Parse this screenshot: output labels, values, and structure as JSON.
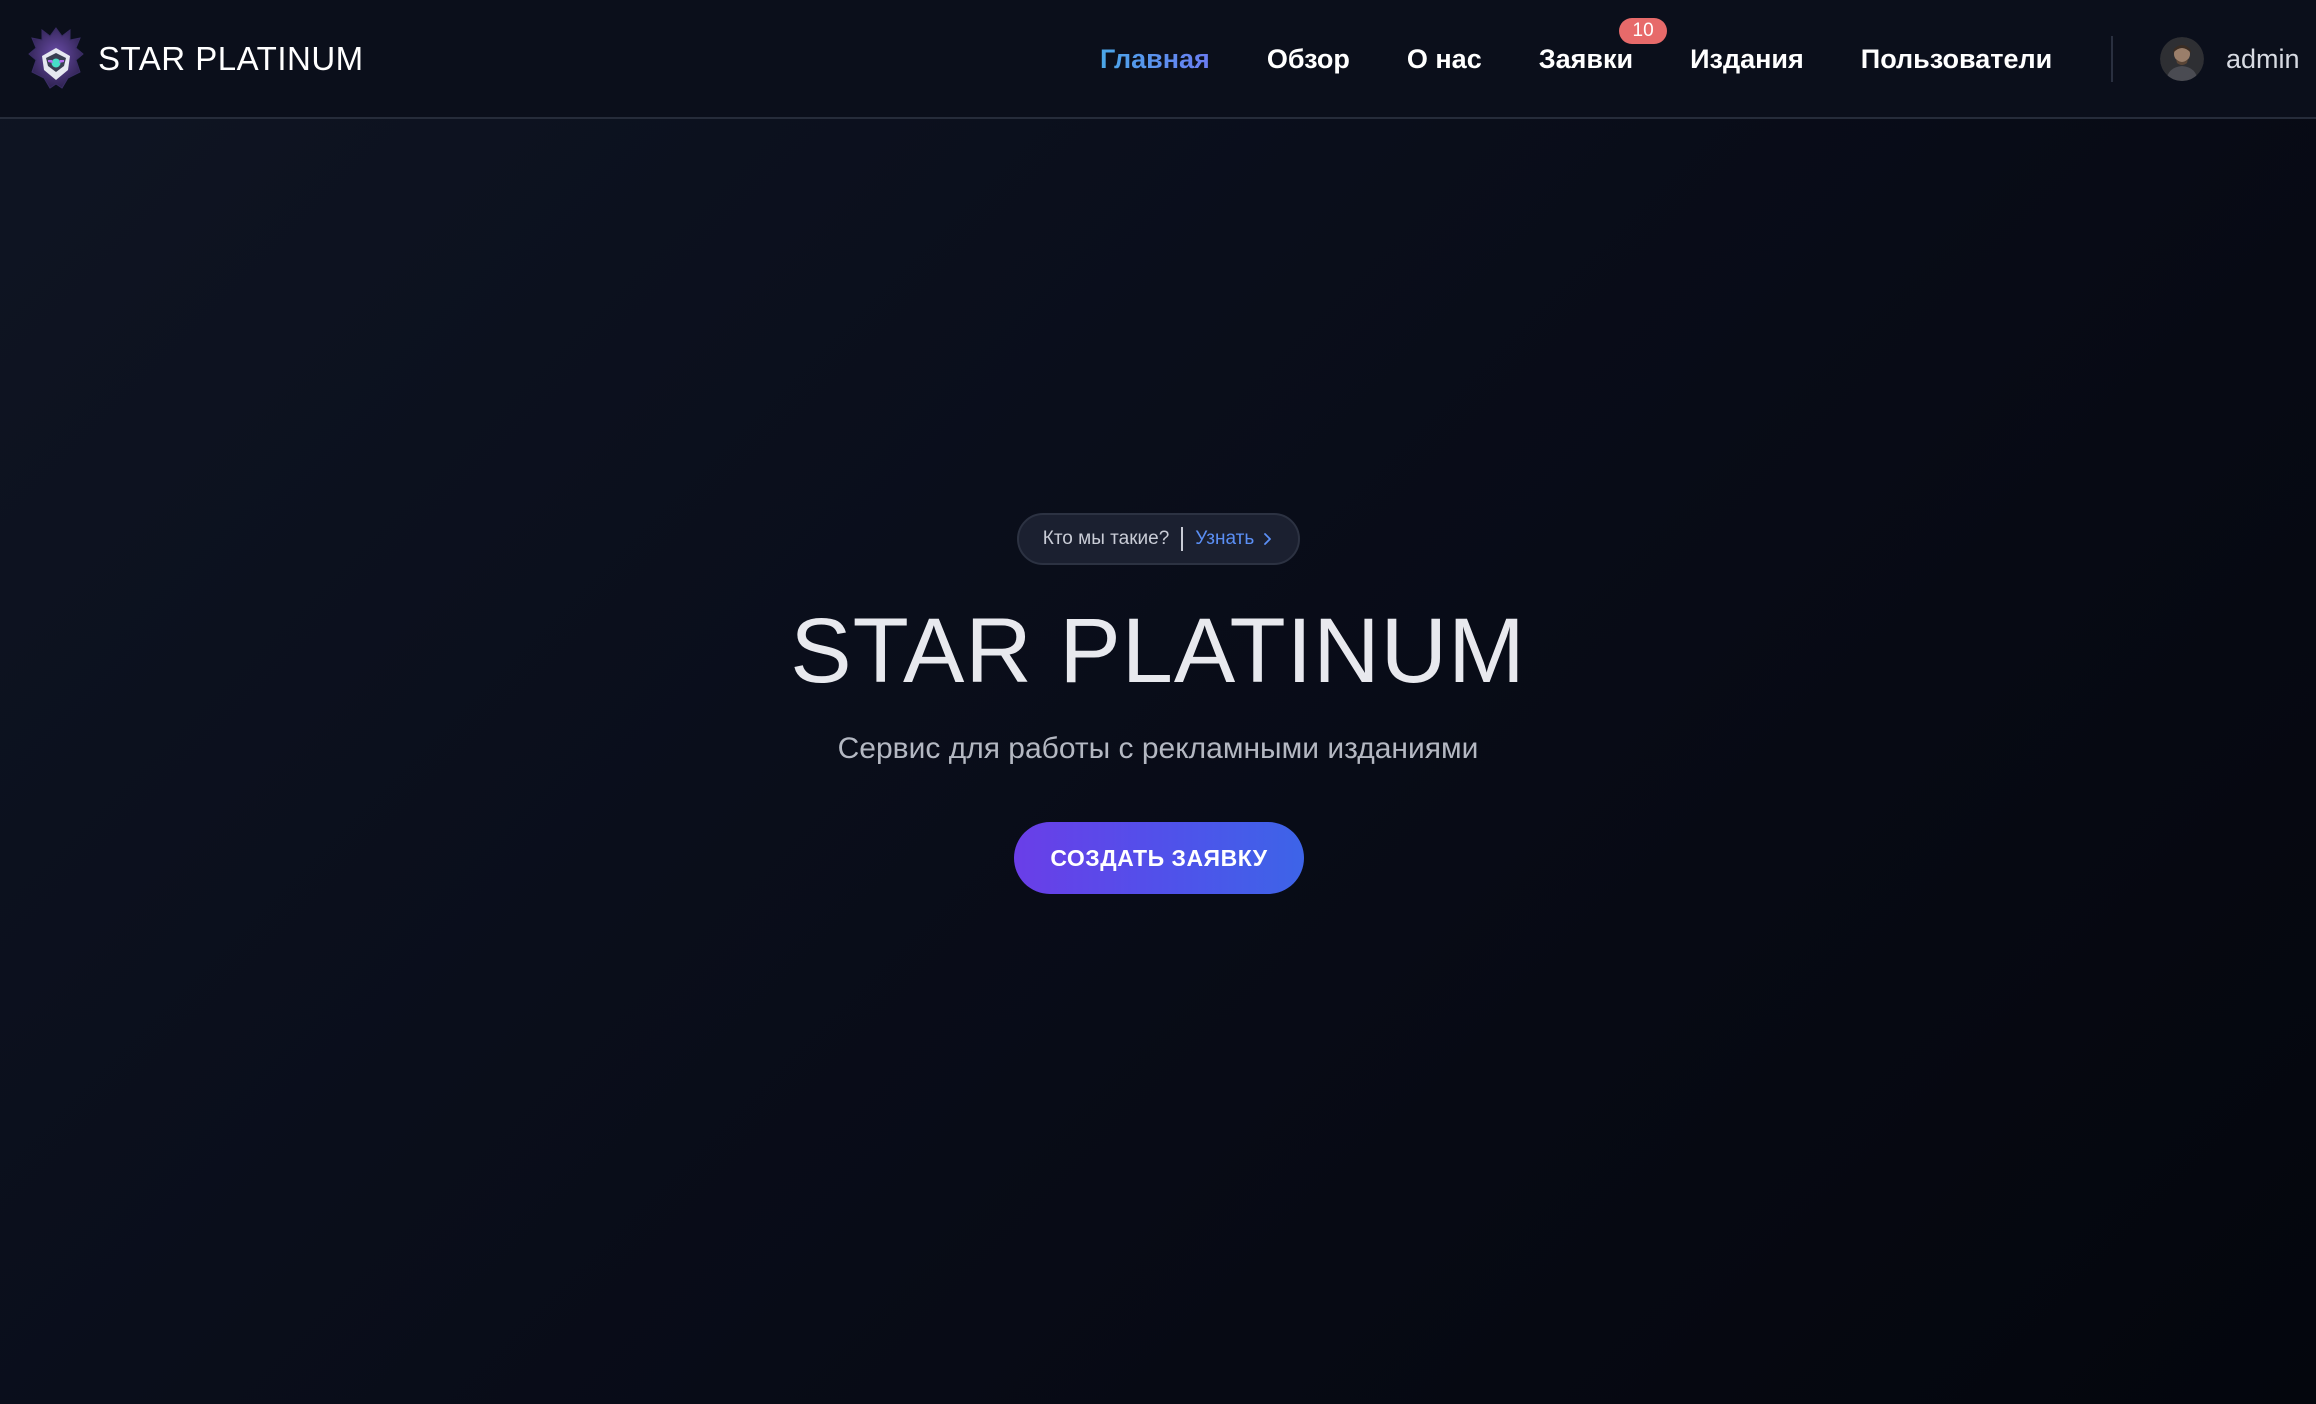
{
  "navbar": {
    "brand": {
      "name": "STAR PLATINUM",
      "logo_icon": "dark-mask-logo-icon"
    },
    "items": [
      {
        "label": "Главная",
        "active": true
      },
      {
        "label": "Обзор",
        "active": false
      },
      {
        "label": "О нас",
        "active": false
      },
      {
        "label": "Заявки",
        "active": false,
        "badge": "10"
      },
      {
        "label": "Издания",
        "active": false
      },
      {
        "label": "Пользователи",
        "active": false
      }
    ],
    "user": {
      "name": "admin",
      "avatar_icon": "user-avatar"
    }
  },
  "hero": {
    "pill": {
      "text": "Кто мы такие?",
      "link": "Узнать",
      "link_icon": "chevron-right-icon"
    },
    "title": "STAR PLATINUM",
    "subtitle": "Сервис для работы с рекламными изданиями",
    "cta_label": "СОЗДАТЬ ЗАЯВКУ"
  },
  "colors": {
    "background": "#070a14",
    "navbar_bg": "#0b0f1b",
    "active_nav": "#5aa6f0",
    "badge": "#e76a6a",
    "link": "#5b8ff5",
    "cta_gradient_start": "#6a3ee8",
    "cta_gradient_end": "#3d64e8"
  }
}
